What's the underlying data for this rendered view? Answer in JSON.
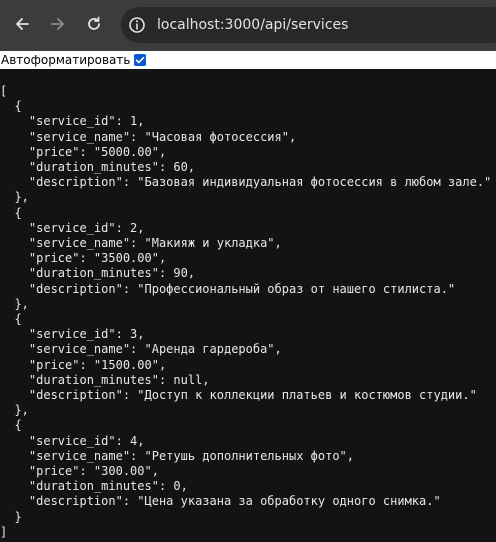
{
  "browser": {
    "url_host": "localhost",
    "url_path": ":3000/api/services",
    "icons": {
      "back": "arrow-left-icon",
      "forward": "arrow-right-icon",
      "reload": "reload-icon",
      "site_info": "site-info-icon"
    }
  },
  "prettyprint": {
    "label": "Автоформатировать",
    "checked": true
  },
  "json_lines": [
    "[",
    "  {",
    "    \"service_id\": 1,",
    "    \"service_name\": \"Часовая фотосессия\",",
    "    \"price\": \"5000.00\",",
    "    \"duration_minutes\": 60,",
    "    \"description\": \"Базовая индивидуальная фотосессия в любом зале.\"",
    "  },",
    "  {",
    "    \"service_id\": 2,",
    "    \"service_name\": \"Макияж и укладка\",",
    "    \"price\": \"3500.00\",",
    "    \"duration_minutes\": 90,",
    "    \"description\": \"Профессиональный образ от нашего стилиста.\"",
    "  },",
    "  {",
    "    \"service_id\": 3,",
    "    \"service_name\": \"Аренда гардероба\",",
    "    \"price\": \"1500.00\",",
    "    \"duration_minutes\": null,",
    "    \"description\": \"Доступ к коллекции платьев и костюмов студии.\"",
    "  },",
    "  {",
    "    \"service_id\": 4,",
    "    \"service_name\": \"Ретушь дополнительных фото\",",
    "    \"price\": \"300.00\",",
    "    \"duration_minutes\": 0,",
    "    \"description\": \"Цена указана за обработку одного снимка.\"",
    "  }",
    "]"
  ]
}
